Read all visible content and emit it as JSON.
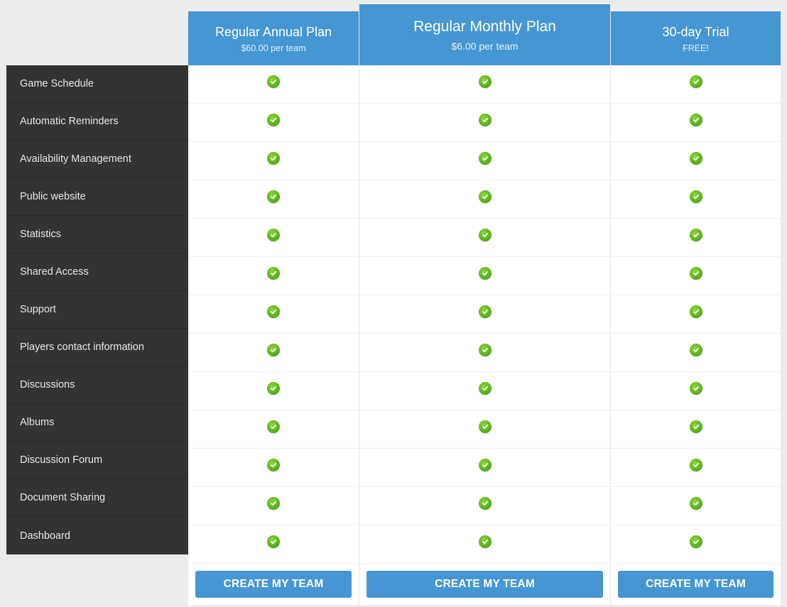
{
  "features": [
    "Game Schedule",
    "Automatic Reminders",
    "Availability Management",
    "Public website",
    "Statistics",
    "Shared Access",
    "Support",
    "Players contact information",
    "Discussions",
    "Albums",
    "Discussion Forum",
    "Document Sharing",
    "Dashboard"
  ],
  "plans": [
    {
      "title": "Regular Annual Plan",
      "price": "$60.00 per team",
      "included": [
        true,
        true,
        true,
        true,
        true,
        true,
        true,
        true,
        true,
        true,
        true,
        true,
        true
      ],
      "cta": "CREATE MY TEAM"
    },
    {
      "title": "Regular Monthly Plan",
      "price": "$6.00 per team",
      "included": [
        true,
        true,
        true,
        true,
        true,
        true,
        true,
        true,
        true,
        true,
        true,
        true,
        true
      ],
      "cta": "CREATE MY TEAM",
      "featured": true
    },
    {
      "title": "30-day Trial",
      "price": "FREE!",
      "included": [
        true,
        true,
        true,
        true,
        true,
        true,
        true,
        true,
        true,
        true,
        true,
        true,
        true
      ],
      "cta": "CREATE MY TEAM"
    }
  ],
  "icons": {
    "included": "check-circle-icon"
  },
  "colors": {
    "accent": "#4596d3",
    "feature_bg": "#333333",
    "check": "#5cb41c",
    "page_bg": "#ebeced"
  }
}
